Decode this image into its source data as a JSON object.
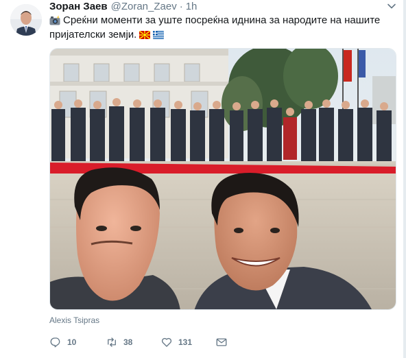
{
  "tweet": {
    "author_name": "Зоран Заев",
    "author_handle": "@Zoran_Zaev",
    "separator": "·",
    "time": "1h",
    "text_line1": "Среќни моменти за уште посреќна иднина за народите на нашите",
    "text_line2": "пријателски земји.",
    "photo_credit": "Alexis Tsipras"
  },
  "actions": {
    "replies": "10",
    "retweets": "38",
    "likes": "131"
  },
  "icons": {
    "avatar": "avatar-photo",
    "caret": "chevron-down-icon",
    "camera": "camera-with-flash-icon",
    "flag_mk": "flag-north-macedonia",
    "flag_gr": "flag-greece",
    "reply": "reply-icon",
    "retweet": "retweet-icon",
    "like": "heart-icon",
    "dm": "envelope-icon"
  },
  "colors": {
    "text_primary": "#14171a",
    "text_secondary": "#657786",
    "border": "#e1e8ed",
    "carpet_red": "#d91d2a"
  }
}
